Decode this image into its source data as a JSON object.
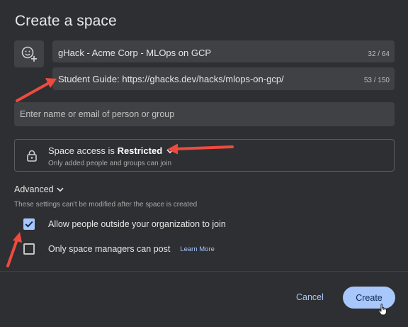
{
  "dialog": {
    "title": "Create a space",
    "name_field": {
      "value": "gHack - Acme Corp - MLOps on GCP",
      "counter": "32 / 64"
    },
    "description_field": {
      "value": "Student Guide: https://ghacks.dev/hacks/mlops-on-gcp/",
      "counter": "53 / 150"
    },
    "people_field": {
      "placeholder": "Enter name or email of person or group"
    },
    "access": {
      "label_prefix": "Space access is",
      "label_value": "Restricted",
      "description": "Only added people and groups can join"
    },
    "advanced": {
      "label": "Advanced",
      "note": "These settings can't be modified after the space is created",
      "options": [
        {
          "label": "Allow people outside your organization to join",
          "checked": true
        },
        {
          "label": "Only space managers can post",
          "checked": false,
          "link": "Learn More"
        }
      ]
    },
    "buttons": {
      "cancel": "Cancel",
      "create": "Create"
    }
  },
  "colors": {
    "background": "#2e2f32",
    "field": "#404144",
    "accent": "#a8c7fa",
    "annotation_arrow": "#ee4b3e"
  },
  "icons": [
    "add-emoji-icon",
    "lock-icon",
    "chevron-down-icon",
    "check-icon",
    "pointer-cursor-icon"
  ]
}
